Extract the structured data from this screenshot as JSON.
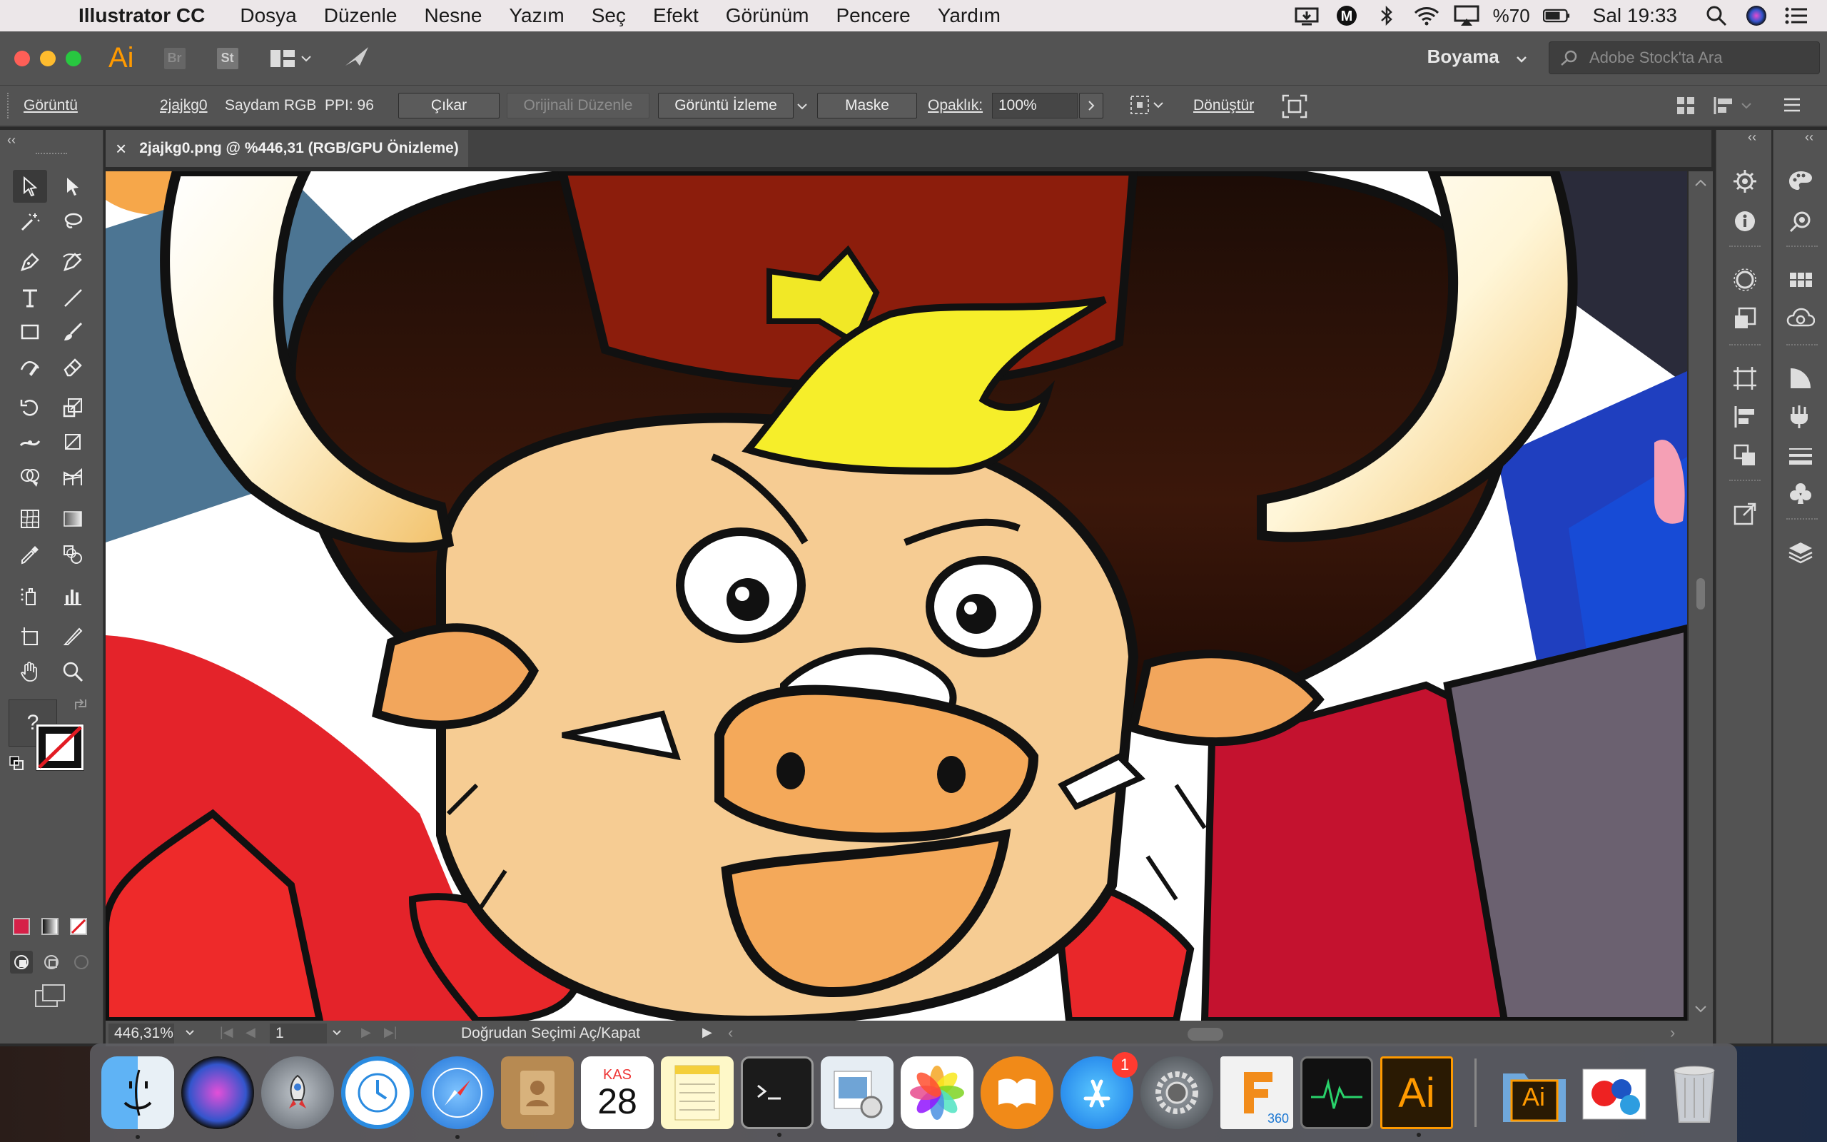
{
  "menubar": {
    "app_name": "Illustrator CC",
    "items": [
      "Dosya",
      "Düzenle",
      "Nesne",
      "Yazım",
      "Seç",
      "Efekt",
      "Görünüm",
      "Pencere",
      "Yardım"
    ],
    "battery_percent": "%70",
    "clock": "Sal 19:33"
  },
  "appbar": {
    "logo": "Ai",
    "bridge": "Br",
    "stock": "St",
    "workspace": "Boyama",
    "stock_search_placeholder": "Adobe Stock'ta Ara"
  },
  "control": {
    "object_type": "Görüntü",
    "file_name": "2jajkg0",
    "color_mode": "Saydam RGB",
    "ppi": "PPI: 96",
    "extract": "Çıkar",
    "edit_original": "Orijinali Düzenle",
    "image_trace": "Görüntü İzleme",
    "mask": "Maske",
    "opacity_label": "Opaklık:",
    "opacity_value": "100%",
    "transform": "Dönüştür"
  },
  "document": {
    "tab_title": "2jajkg0.png @ %446,31 (RGB/GPU Önizleme)",
    "close_glyph": "×"
  },
  "status": {
    "zoom": "446,31%",
    "artboard": "1",
    "message": "Doğrudan Seçimi Aç/Kapat"
  },
  "toolbox": {
    "unknown_glyph": "?"
  },
  "dock": {
    "calendar_month": "KAS",
    "calendar_day": "28",
    "appstore_badge": "1",
    "fusion_label": "360",
    "illustrator_label": "Ai",
    "folder_label": "Ai"
  },
  "colors": {
    "accent": "#ff9a00",
    "ui_panel": "#535353",
    "menubar": "#ece7e9"
  }
}
